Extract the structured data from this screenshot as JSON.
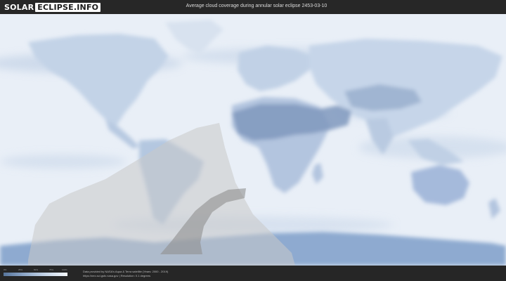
{
  "header": {
    "logo_part1": "SOLAR",
    "logo_part2": "ECLIPSE.INFO",
    "title": "Average cloud coverage during annular solar eclipse 2453-03-10"
  },
  "map": {
    "water_color": "#e9eff7",
    "land_color": "#c9d7e8",
    "desert_color": "#7f98bd",
    "ice_color": "#8eaad0",
    "eclipse_overlay_color": "#c9c9c9"
  },
  "legend": {
    "scale_labels": [
      "0%",
      "25%",
      "50%",
      "75%",
      "100%"
    ],
    "colors": [
      "#57759c",
      "#8fa8c9",
      "#c7d6e8",
      "#f5f8fc"
    ]
  },
  "footer": {
    "credit_line1": "Data provided by NASA's Aqua & Terra satellite (Years: 2000 - 2019)",
    "credit_line2": "https://neo.sci.gsfc.nasa.gov | Resolution: 0.1 degrees"
  }
}
